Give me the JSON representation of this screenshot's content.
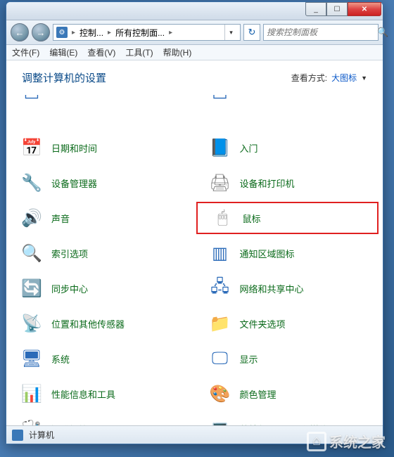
{
  "titlebar": {
    "min": "_",
    "max": "☐",
    "close": "✕"
  },
  "nav": {
    "back_arrow": "←",
    "fwd_arrow": "→",
    "crumb1": "控制...",
    "crumb2": "所有控制面...",
    "sep": "▸",
    "dropdown": "▾",
    "refresh": "↻"
  },
  "search": {
    "placeholder": "搜索控制面板",
    "icon": "🔍"
  },
  "menu": {
    "file": "文件(F)",
    "edit": "编辑(E)",
    "view": "查看(V)",
    "tools": "工具(T)",
    "help": "帮助(H)"
  },
  "header": {
    "title": "调整计算机的设置",
    "view_label": "查看方式:",
    "view_value": "大图标",
    "drop": "▼"
  },
  "items_left": [
    {
      "id": "datetime",
      "label": "日期和时间",
      "icon": "📅",
      "cls": "ic-blue"
    },
    {
      "id": "devicemgr",
      "label": "设备管理器",
      "icon": "🔧",
      "cls": "ic-teal"
    },
    {
      "id": "sound",
      "label": "声音",
      "icon": "🔊",
      "cls": "ic-gray"
    },
    {
      "id": "indexing",
      "label": "索引选项",
      "icon": "🔍",
      "cls": "ic-orange"
    },
    {
      "id": "sync",
      "label": "同步中心",
      "icon": "🔄",
      "cls": "ic-green"
    },
    {
      "id": "location",
      "label": "位置和其他传感器",
      "icon": "📡",
      "cls": "ic-orange"
    },
    {
      "id": "system",
      "label": "系统",
      "icon": "🖥",
      "cls": "ic-blue"
    },
    {
      "id": "perfinfo",
      "label": "性能信息和工具",
      "icon": "📊",
      "cls": "ic-blue"
    },
    {
      "id": "troubleshoot",
      "label": "疑难解答",
      "icon": "🩺",
      "cls": "ic-blue"
    }
  ],
  "items_right": [
    {
      "id": "gettingstarted",
      "label": "入门",
      "icon": "📘",
      "cls": "ic-blue"
    },
    {
      "id": "devprinters",
      "label": "设备和打印机",
      "icon": "🖨",
      "cls": "ic-gray"
    },
    {
      "id": "mouse",
      "label": "鼠标",
      "icon": "🖱",
      "cls": "ic-gray",
      "highlighted": true
    },
    {
      "id": "notifyarea",
      "label": "通知区域图标",
      "icon": "▥",
      "cls": "ic-blue"
    },
    {
      "id": "netshare",
      "label": "网络和共享中心",
      "icon": "🖧",
      "cls": "ic-blue"
    },
    {
      "id": "folderopts",
      "label": "文件夹选项",
      "icon": "📁",
      "cls": "ic-orange"
    },
    {
      "id": "display",
      "label": "显示",
      "icon": "🖵",
      "cls": "ic-blue"
    },
    {
      "id": "colormgmt",
      "label": "颜色管理",
      "icon": "🎨",
      "cls": "ic-orange"
    },
    {
      "id": "intelgfx",
      "label": "英特尔(R) 图形和媒体",
      "icon": "💻",
      "cls": "ic-gray"
    }
  ],
  "statusbar": {
    "label": "计算机"
  },
  "watermark": {
    "text": "系统之家"
  }
}
